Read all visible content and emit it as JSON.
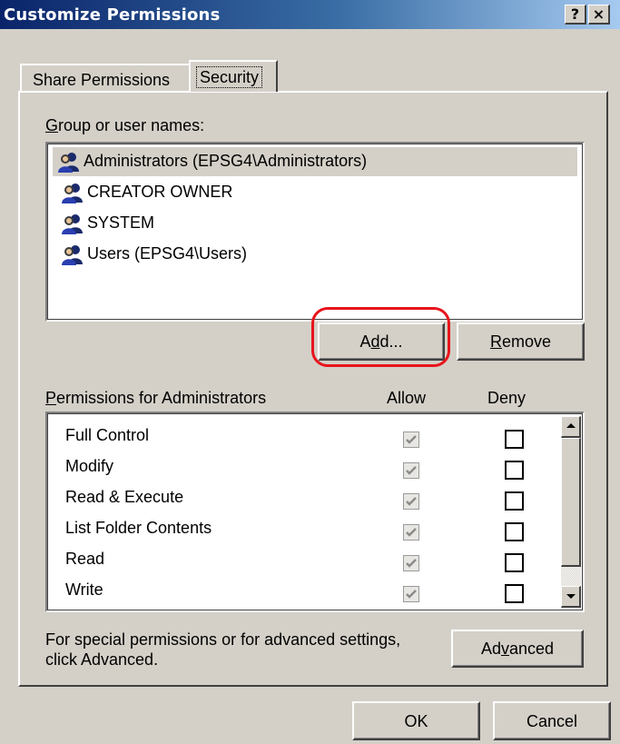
{
  "window": {
    "title": "Customize Permissions",
    "help_button": "?",
    "close_button": "×"
  },
  "tabs": [
    {
      "label": "Share Permissions",
      "active": false
    },
    {
      "label": "Security",
      "active": true
    }
  ],
  "users_section": {
    "label_prefix": "",
    "label_accel": "G",
    "label_rest": "roup or user names:",
    "users": [
      {
        "name": "Administrators (EPSG4\\Administrators)",
        "icon": "users-group-icon",
        "selected": true
      },
      {
        "name": "CREATOR OWNER",
        "icon": "users-group-icon",
        "selected": false
      },
      {
        "name": "SYSTEM",
        "icon": "users-group-icon",
        "selected": false
      },
      {
        "name": "Users (EPSG4\\Users)",
        "icon": "users-group-icon",
        "selected": false
      }
    ],
    "add_button": {
      "pre": "A",
      "accel": "d",
      "post": "d..."
    },
    "remove_button": {
      "pre": "",
      "accel": "R",
      "post": "emove"
    }
  },
  "permissions_section": {
    "label_accel": "P",
    "label_rest": "ermissions for Administrators",
    "allow_header": "Allow",
    "deny_header": "Deny",
    "permissions": [
      {
        "name": "Full Control",
        "allow": true,
        "deny": false
      },
      {
        "name": "Modify",
        "allow": true,
        "deny": false
      },
      {
        "name": "Read & Execute",
        "allow": true,
        "deny": false
      },
      {
        "name": "List Folder Contents",
        "allow": true,
        "deny": false
      },
      {
        "name": "Read",
        "allow": true,
        "deny": false
      },
      {
        "name": "Write",
        "allow": true,
        "deny": false
      }
    ]
  },
  "advanced": {
    "text_line1": "For special permissions or for advanced settings,",
    "text_line2": "click Advanced.",
    "button": {
      "pre": "Ad",
      "accel": "v",
      "post": "anced"
    }
  },
  "footer": {
    "ok_label": "OK",
    "cancel_label": "Cancel"
  },
  "colors": {
    "title_gradient_start": "#0a246a",
    "title_gradient_end": "#a6caf0",
    "dialog_face": "#d4d0c8",
    "annotation_ring": "#e8141c"
  }
}
